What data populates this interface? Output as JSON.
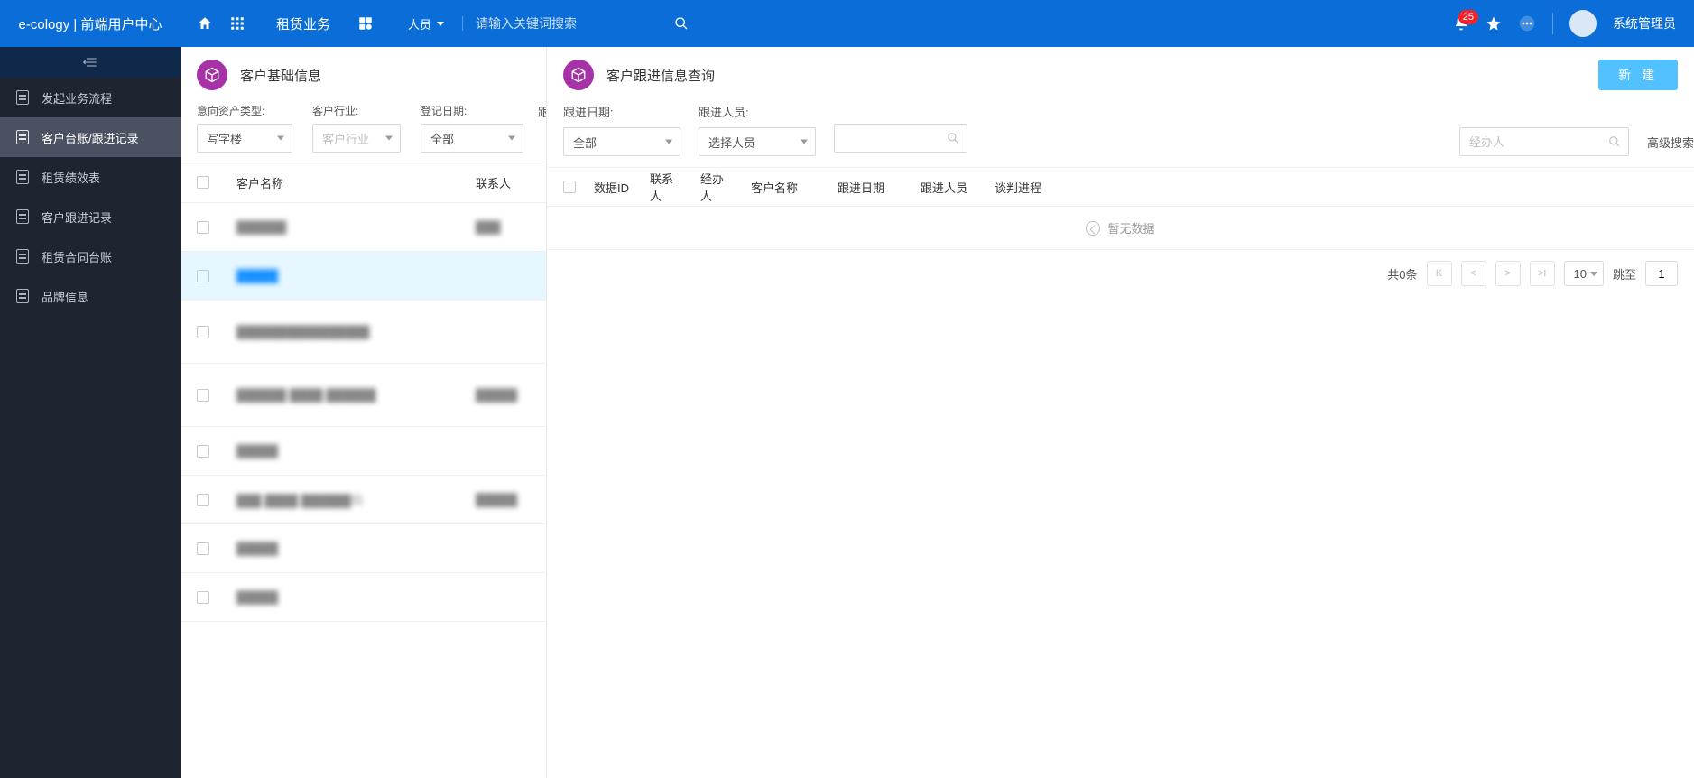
{
  "topbar": {
    "brand": "e-cology | 前端用户中心",
    "module": "租赁业务",
    "people_label": "人员",
    "search_placeholder": "请输入关键词搜索",
    "notification_count": "25",
    "username": "系统管理员"
  },
  "sidebar": {
    "items": [
      {
        "label": "发起业务流程"
      },
      {
        "label": "客户台账/跟进记录"
      },
      {
        "label": "租赁绩效表"
      },
      {
        "label": "客户跟进记录"
      },
      {
        "label": "租赁合同台账"
      },
      {
        "label": "品牌信息"
      }
    ],
    "active_index": 1
  },
  "left_panel": {
    "title": "客户基础信息",
    "filters": {
      "asset_type_label": "意向资产类型:",
      "asset_type_value": "写字楼",
      "industry_label": "客户行业:",
      "industry_placeholder": "客户行业",
      "reg_date_label": "登记日期:",
      "reg_date_value": "全部",
      "extra_label": "跟"
    },
    "columns": {
      "name": "客户名称",
      "contact": "联系人"
    },
    "rows": [
      {
        "name": "██████",
        "contact": "███"
      },
      {
        "name": "█████",
        "contact": ""
      },
      {
        "name": "████████████████",
        "contact": ""
      },
      {
        "name": "██████ ████ ██████",
        "contact": "█████"
      },
      {
        "name": "█████",
        "contact": ""
      },
      {
        "name": "███ ████ ██████司",
        "contact": "█████"
      },
      {
        "name": "█████",
        "contact": ""
      },
      {
        "name": "█████",
        "contact": ""
      }
    ],
    "selected_row": 1
  },
  "right_panel": {
    "title": "客户跟进信息查询",
    "new_button": "新 建",
    "filters": {
      "date_label": "跟进日期:",
      "date_value": "全部",
      "person_label": "跟进人员:",
      "person_placeholder": "选择人员"
    },
    "handler_placeholder": "经办人",
    "adv_search": "高级搜索",
    "columns": {
      "id": "数据ID",
      "contact": "联系人",
      "handler": "经办人",
      "customer": "客户名称",
      "date": "跟进日期",
      "person": "跟进人员",
      "progress": "谈判进程"
    },
    "empty_text": "暂无数据",
    "pagination": {
      "total_prefix": "共",
      "total_count": "0",
      "total_suffix": "条",
      "page_size": "10",
      "jump_label": "跳至",
      "jump_value": "1"
    }
  }
}
